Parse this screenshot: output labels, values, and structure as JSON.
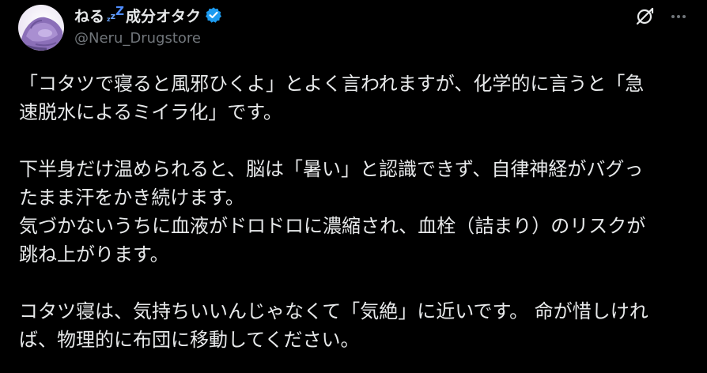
{
  "author": {
    "name_part1": "ねる",
    "zzz": [
      "z",
      "z",
      "Z"
    ],
    "name_part2": "成分オタク",
    "handle": "@Neru_Drugstore"
  },
  "colors": {
    "background": "#000000",
    "text": "#e7e9ea",
    "muted": "#71767b",
    "verified": "#1d9bf0"
  },
  "icons": {
    "verified": "verified-badge-icon",
    "grok": "grok-icon",
    "more": "more-dots-icon"
  },
  "post": {
    "paragraph1": [
      "「コタツで寝ると風邪ひくよ」とよく言われますが、化学的に言うと「急",
      "速脱水によるミイラ化」です。"
    ],
    "paragraph2": [
      "下半身だけ温められると、脳は「暑い」と認識できず、自律神経がバグっ",
      "たまま汗をかき続けます。"
    ],
    "paragraph3": [
      "気づかないうちに血液がドロドロに濃縮され、血栓（詰まり）のリスクが",
      "跳ね上がります。"
    ],
    "paragraph4": [
      "コタツ寝は、気持ちいいんじゃなくて「気絶」に近いです。 命が惜しけれ",
      "ば、物理的に布団に移動してください。"
    ]
  }
}
